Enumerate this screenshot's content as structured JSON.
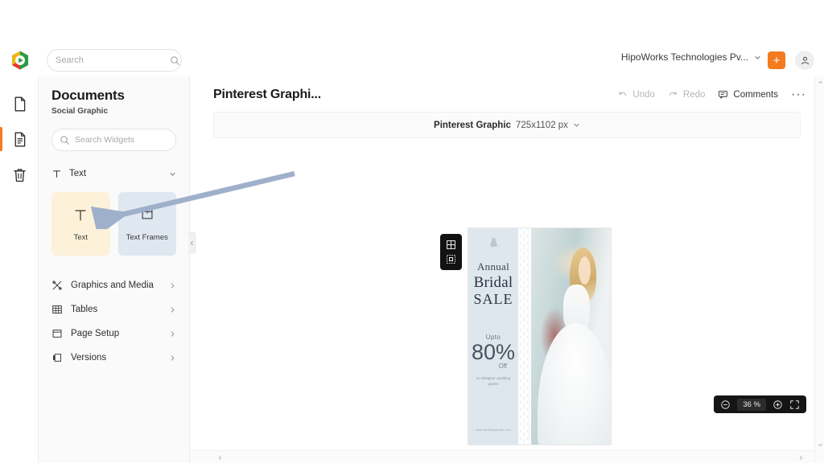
{
  "app": {
    "logo_icon": "zoho-show-logo-icon"
  },
  "topbar": {
    "search": {
      "placeholder": "Search",
      "value": "",
      "icon": "search-icon"
    },
    "org_name": "HipoWorks Technologies Pv...",
    "org_chevron_icon": "chevron-down-icon",
    "create_label": "+",
    "avatar_icon": "user-avatar-icon"
  },
  "rail": {
    "items": [
      {
        "name": "documents",
        "icon": "blank-document-icon",
        "active": false
      },
      {
        "name": "current-document",
        "icon": "document-lines-icon",
        "active": true
      },
      {
        "name": "trash",
        "icon": "trash-icon",
        "active": false
      }
    ]
  },
  "panel": {
    "title": "Documents",
    "subtitle": "Social Graphic",
    "search": {
      "placeholder": "Search Widgets",
      "value": "",
      "icon": "search-icon"
    },
    "section": {
      "label": "Text",
      "icon": "text-t-icon",
      "chevron_icon": "chevron-down-icon",
      "expanded": true
    },
    "cards": [
      {
        "label": "Text",
        "icon": "text-t-icon",
        "state": "highlighted",
        "bg": "#fdf2d9"
      },
      {
        "label": "Text Frames",
        "icon": "text-frame-icon",
        "state": "normal",
        "bg": "#dfe7f0"
      }
    ],
    "menu": [
      {
        "label": "Graphics and Media",
        "icon": "graphics-media-icon",
        "chevron": "chevron-right-icon"
      },
      {
        "label": "Tables",
        "icon": "table-grid-icon",
        "chevron": "chevron-right-icon"
      },
      {
        "label": "Page Setup",
        "icon": "page-setup-icon",
        "chevron": "chevron-right-icon"
      },
      {
        "label": "Versions",
        "icon": "versions-icon",
        "chevron": "chevron-right-icon"
      }
    ],
    "collapse_icon": "chevron-left-icon"
  },
  "editor": {
    "document_title": "Pinterest Graphi...",
    "actions": {
      "undo": {
        "label": "Undo",
        "icon": "undo-arrow-icon",
        "enabled": false
      },
      "redo": {
        "label": "Redo",
        "icon": "redo-arrow-icon",
        "enabled": false
      },
      "comments": {
        "label": "Comments",
        "icon": "comment-bubble-icon",
        "enabled": true
      },
      "more": {
        "label": "···",
        "icon": "more-options-icon"
      }
    },
    "size_bar": {
      "name": "Pinterest Graphic",
      "dimensions": "725x1102 px",
      "chevron_icon": "chevron-down-icon"
    },
    "tool_strip": [
      {
        "name": "layout-grid",
        "icon": "layout-grid-icon"
      },
      {
        "name": "crop-select",
        "icon": "crop-marquee-icon"
      }
    ],
    "zoom": {
      "minus_icon": "zoom-out-circle-icon",
      "value": "36",
      "unit": "%",
      "plus_icon": "zoom-in-circle-icon",
      "fit_icon": "fit-to-screen-icon"
    },
    "scroll": {
      "up_icon": "caret-up-icon",
      "down_icon": "caret-down-icon",
      "left_icon": "caret-left-icon",
      "right_icon": "caret-right-icon"
    }
  },
  "poster": {
    "dress_icon": "dress-icon",
    "annual": "Annual",
    "bridal": "Bridal",
    "sale": "SALE",
    "upto": "Upto",
    "percent": "80%",
    "off": "Off",
    "note": "on designer wedding gowns",
    "url": "www.weddingstudio.com"
  },
  "annotation": {
    "arrow": "callout-arrow",
    "color": "#9fb0cb",
    "points_to": "text-widget-card"
  }
}
